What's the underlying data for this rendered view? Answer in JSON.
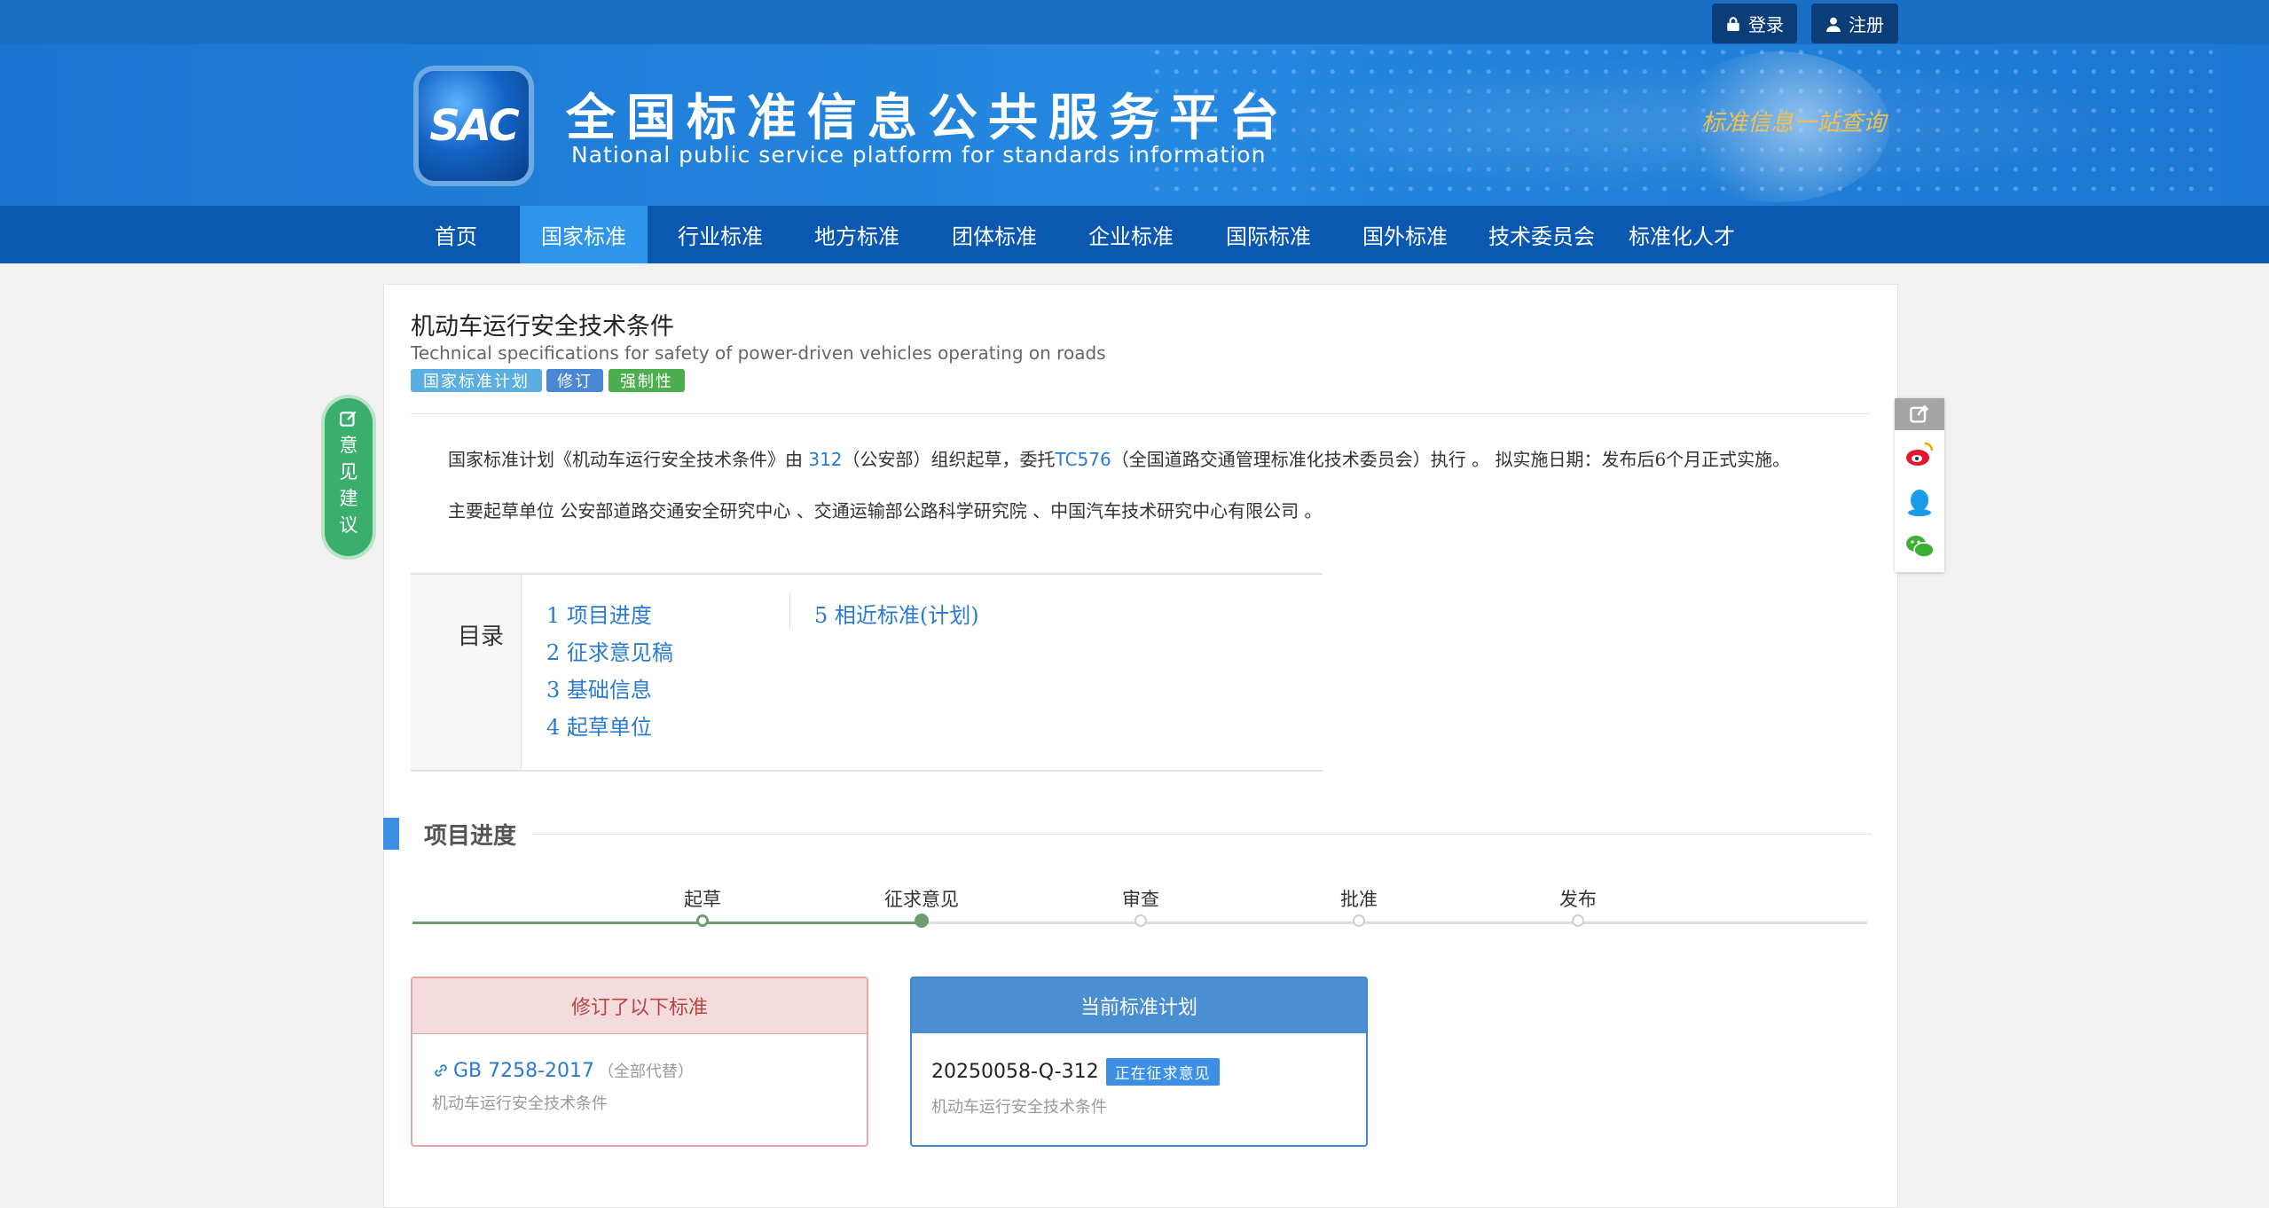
{
  "topbar": {
    "login_label": "登录",
    "register_label": "注册"
  },
  "header": {
    "logo_text": "SAC",
    "title": "全国标准信息公共服务平台",
    "subtitle": "National public service platform  for standards information",
    "slogan": "标准信息一站查询"
  },
  "nav": {
    "items": [
      {
        "label": "首页"
      },
      {
        "label": "国家标准"
      },
      {
        "label": "行业标准"
      },
      {
        "label": "地方标准"
      },
      {
        "label": "团体标准"
      },
      {
        "label": "企业标准"
      },
      {
        "label": "国际标准"
      },
      {
        "label": "国外标准"
      },
      {
        "label": "技术委员会"
      },
      {
        "label": "标准化人才"
      }
    ],
    "active_index": 1
  },
  "detail": {
    "title_cn": "机动车运行安全技术条件",
    "title_en": "Technical specifications for safety of power-driven vehicles operating on roads",
    "tags": [
      {
        "label": "国家标准计划",
        "color": "#5aaee0"
      },
      {
        "label": "修订",
        "color": "#4a86d6"
      },
      {
        "label": "强制性",
        "color": "#4cae4c"
      }
    ],
    "para1": {
      "before": "国家标准计划《机动车运行安全技术条件》由 ",
      "dept_code": "312",
      "mid1": "（公安部）组织起草，委托",
      "tc_code": "TC576",
      "after": "（全国道路交通管理标准化技术委员会）执行 。 拟实施日期：发布后6个月正式实施。"
    },
    "para2": "主要起草单位 公安部道路交通安全研究中心 、交通运输部公路科学研究院 、中国汽车技术研究中心有限公司 。"
  },
  "toc": {
    "title": "目录",
    "items": [
      "1  项目进度",
      "2  征求意见稿",
      "3  基础信息",
      "4  起草单位",
      "5  相近标准(计划)"
    ]
  },
  "progress": {
    "section_title": "项目进度",
    "steps": [
      {
        "label": "起草",
        "state": "done"
      },
      {
        "label": "征求意见",
        "state": "current"
      },
      {
        "label": "审查",
        "state": "pending"
      },
      {
        "label": "批准",
        "state": "pending"
      },
      {
        "label": "发布",
        "state": "pending"
      }
    ]
  },
  "revised": {
    "header": "修订了以下标准",
    "code": "GB 7258-2017",
    "note": "（全部代替）",
    "name": "机动车运行安全技术条件"
  },
  "current": {
    "header": "当前标准计划",
    "code": "20250058-Q-312",
    "status": "正在征求意见",
    "name": "机动车运行安全技术条件"
  },
  "feedback": {
    "label": "意见建议"
  },
  "colors": {
    "primary": "#1a6fc4",
    "nav": "#0a58b0",
    "nav_active": "#2e95ea",
    "link": "#2a7bd0",
    "done": "#6c9d6f",
    "revised_border": "#e9a5a5",
    "current_border": "#3f87d0"
  }
}
